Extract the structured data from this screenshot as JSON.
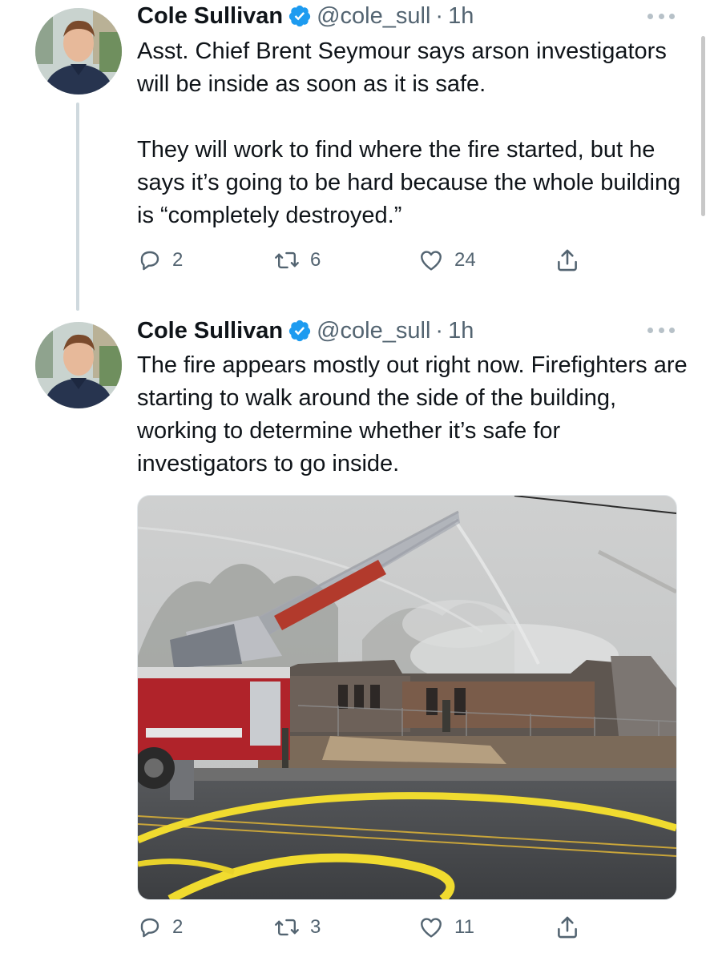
{
  "tweets": [
    {
      "author_name": "Cole Sullivan",
      "handle": "@cole_sull",
      "separator": "·",
      "time": "1h",
      "text": "Asst. Chief Brent Seymour says arson investigators will be inside as soon as it is safe.\n\nThey will work to find where the fire started, but he says it’s going to be hard because the whole building is “completely destroyed.”",
      "replies": "2",
      "retweets": "6",
      "likes": "24"
    },
    {
      "author_name": "Cole Sullivan",
      "handle": "@cole_sull",
      "separator": "·",
      "time": "1h",
      "text": "The fire appears mostly out right now. Firefighters are starting to walk around the side of the building, working to determine whether it’s safe for investigators to go inside.",
      "replies": "2",
      "retweets": "3",
      "likes": "11"
    }
  ],
  "colors": {
    "verified_blue": "#1d9bf0",
    "secondary_text": "#536471",
    "primary_text": "#0f1419",
    "thread_line": "#cfd9de"
  },
  "icons": {
    "reply": "reply-icon",
    "retweet": "retweet-icon",
    "like": "heart-icon",
    "share": "share-icon",
    "more": "more-options-icon",
    "verified": "verified-badge-icon"
  }
}
